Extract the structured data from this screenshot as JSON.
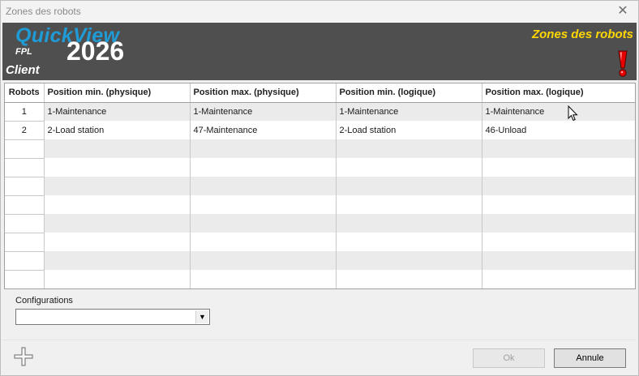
{
  "window": {
    "title": "Zones des robots",
    "close_glyph": "✕"
  },
  "banner": {
    "brand": "QuickView",
    "year": "2026",
    "fpl": "FPL",
    "client": "Client",
    "headline": "Zones des robots",
    "alert_icon": "exclamation-icon",
    "colors": {
      "background": "#4f4f4f",
      "brand": "#1f9bd6",
      "headline": "#ffd700",
      "alert": "#e60000"
    }
  },
  "table": {
    "columns": [
      "Robots",
      "Position min. (physique)",
      "Position max. (physique)",
      "Position min. (logique)",
      "Position max. (logique)"
    ],
    "rows": [
      {
        "robot": "1",
        "cells": [
          "1-Maintenance",
          "1-Maintenance",
          "1-Maintenance",
          "1-Maintenance"
        ]
      },
      {
        "robot": "2",
        "cells": [
          "2-Load station",
          "47-Maintenance",
          "2-Load station",
          "46-Unload"
        ]
      }
    ],
    "empty_rows": 8
  },
  "configurations": {
    "label": "Configurations",
    "value": ""
  },
  "buttons": {
    "ok": "Ok",
    "cancel": "Annule",
    "add_icon": "plus-icon"
  }
}
